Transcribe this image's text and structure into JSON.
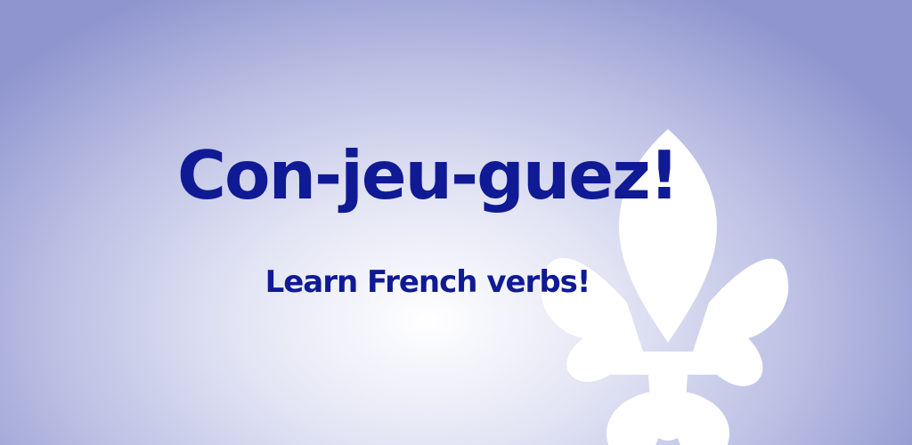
{
  "banner": {
    "title": "Con-jeu-guez!",
    "subtitle": "Learn French verbs!",
    "emblem_icon": "fleur-de-lis-icon",
    "colors": {
      "text": "#0f1a94",
      "background_center": "#ffffff",
      "background_edge": "#8f96cf",
      "emblem": "#ffffff"
    }
  }
}
